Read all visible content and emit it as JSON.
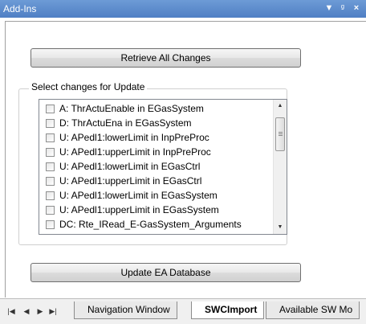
{
  "window": {
    "title": "Add-Ins",
    "controls": [
      "dropdown-icon",
      "pin-icon",
      "close-icon"
    ]
  },
  "buttons": {
    "retrieve": "Retrieve All Changes",
    "update": "Update EA Database"
  },
  "group": {
    "label": "Select changes for Update",
    "items": [
      {
        "label": "A: ThrActuEnable in EGasSystem",
        "checked": false
      },
      {
        "label": "D: ThrActuEna in EGasSystem",
        "checked": false
      },
      {
        "label": "U: APedl1:lowerLimit in InpPreProc",
        "checked": false
      },
      {
        "label": "U: APedl1:upperLimit in InpPreProc",
        "checked": false
      },
      {
        "label": "U: APedl1:lowerLimit in EGasCtrl",
        "checked": false
      },
      {
        "label": "U: APedl1:upperLimit in EGasCtrl",
        "checked": false
      },
      {
        "label": "U: APedl1:lowerLimit in EGasSystem",
        "checked": false
      },
      {
        "label": "U: APedl1:upperLimit in EGasSystem",
        "checked": false
      },
      {
        "label": "DC: Rte_IRead_E-GasSystem_Arguments",
        "checked": false
      }
    ]
  },
  "tabs": [
    {
      "label": "Navigation Window",
      "active": false
    },
    {
      "label": "SWCImport",
      "active": true
    },
    {
      "label": "Available SW Mo",
      "active": false
    }
  ],
  "tab_nav": [
    "first-icon",
    "prev-icon",
    "next-icon",
    "last-icon"
  ]
}
